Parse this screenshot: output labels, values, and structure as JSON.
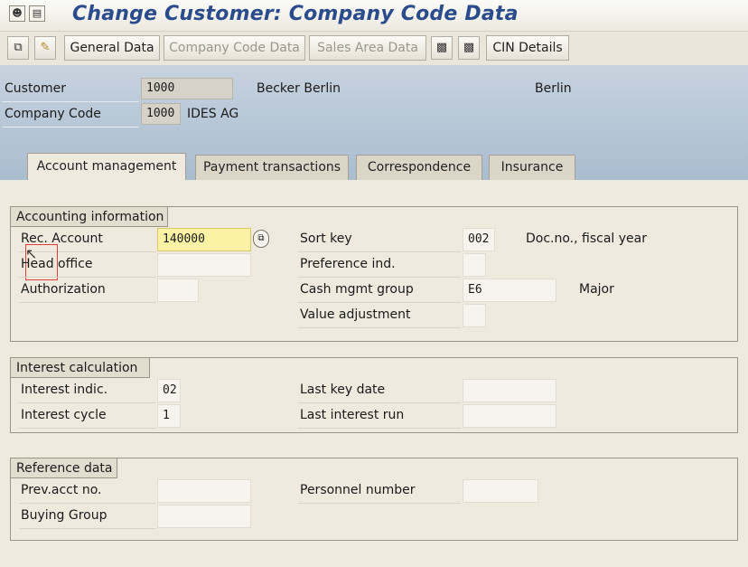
{
  "window": {
    "title": "Change Customer: Company Code Data"
  },
  "toolbar": {
    "buttons": [
      {
        "label": "General Data",
        "enabled": true
      },
      {
        "label": "Company Code Data",
        "enabled": false
      },
      {
        "label": "Sales Area Data",
        "enabled": false
      },
      {
        "label": "CIN Details",
        "enabled": true
      }
    ]
  },
  "header": {
    "customer_label": "Customer",
    "customer_value": "1000",
    "customer_name": "Becker Berlin",
    "customer_city": "Berlin",
    "company_code_label": "Company Code",
    "company_code_value": "1000",
    "company_code_name": "IDES AG"
  },
  "tabs": [
    {
      "label": "Account management",
      "active": true
    },
    {
      "label": "Payment transactions",
      "active": false
    },
    {
      "label": "Correspondence",
      "active": false
    },
    {
      "label": "Insurance",
      "active": false
    }
  ],
  "groups": {
    "accounting": {
      "title": "Accounting information",
      "rec_account_label": "Rec. Account",
      "rec_account_value": "140000",
      "head_office_label": "Head office",
      "head_office_value": "",
      "authorization_label": "Authorization",
      "authorization_value": "",
      "sort_key_label": "Sort key",
      "sort_key_value": "002",
      "sort_key_desc": "Doc.no., fiscal year",
      "preference_label": "Preference ind.",
      "preference_value": "",
      "cash_mgmt_label": "Cash mgmt group",
      "cash_mgmt_value": "E6",
      "cash_mgmt_desc": "Major",
      "value_adj_label": "Value adjustment",
      "value_adj_value": ""
    },
    "interest": {
      "title": "Interest calculation",
      "indic_label": "Interest indic.",
      "indic_value": "02",
      "cycle_label": "Interest cycle",
      "cycle_value": "1",
      "last_key_date_label": "Last key date",
      "last_key_date_value": "",
      "last_run_label": "Last interest run",
      "last_run_value": ""
    },
    "reference": {
      "title": "Reference data",
      "prev_acct_label": "Prev.acct no.",
      "prev_acct_value": "",
      "buying_group_label": "Buying Group",
      "buying_group_value": "",
      "personnel_label": "Personnel number",
      "personnel_value": ""
    }
  }
}
